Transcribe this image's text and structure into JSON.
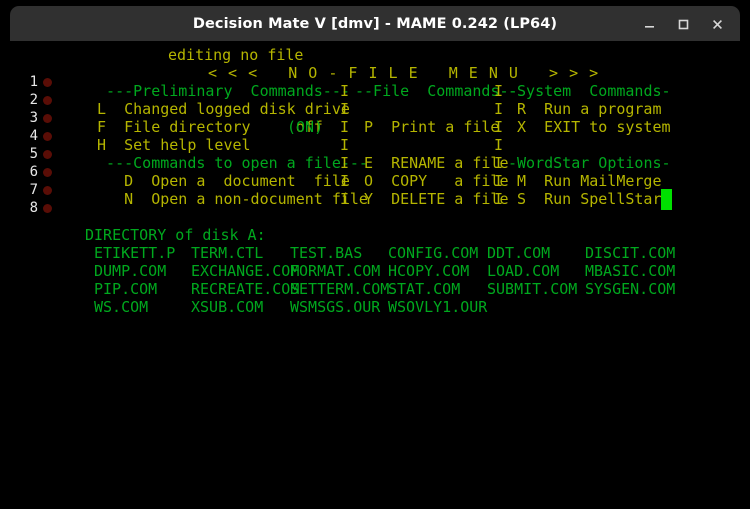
{
  "window": {
    "title": "Decision Mate V [dmv] - MAME 0.242 (LP64)",
    "controls": {
      "minimize_label": "minimize-window",
      "maximize_label": "maximize-window",
      "close_label": "close-window"
    }
  },
  "screen": {
    "status_line": "editing no file",
    "menu_header": "< < <   N O - F I L E   M E N U   > > >",
    "gutter": {
      "numbers": [
        "1",
        "2",
        "3",
        "4",
        "5",
        "6",
        "7",
        "8"
      ]
    },
    "menu": {
      "col1_rows": [
        "  ---Preliminary  Commands---",
        " L  Changed logged disk drive",
        " F  File directory     off ",
        " H  Set help level",
        "  ---Commands to open a file---",
        "    D  Open a  document  file",
        "    N  Open a non-document file"
      ],
      "file_dir_toggle": "(ON)",
      "col2_header": "--File  Commands--",
      "col2_rows": [
        "",
        "P  Print a file",
        "",
        "E  RENAME a file",
        "O  COPY   a file",
        "Y  DELETE a file"
      ],
      "col3_header": "-System  Commands-",
      "col3_rows": [
        "R  Run a program",
        "X  EXIT to system",
        ""
      ],
      "col3_header2": "-WordStar Options-",
      "col3_rows2": [
        "M  Run MailMerge",
        "S  Run SpellStar"
      ],
      "divider": "I"
    },
    "directory": {
      "title": "DIRECTORY of disk A:",
      "rows": [
        [
          "ETIKETT.P",
          "TERM.CTL",
          "TEST.BAS",
          "CONFIG.COM",
          "DDT.COM",
          "DISCIT.COM"
        ],
        [
          "DUMP.COM",
          "EXCHANGE.COM",
          "FORMAT.COM",
          "HCOPY.COM",
          "LOAD.COM",
          "MBASIC.COM"
        ],
        [
          "PIP.COM",
          "RECREATE.COM",
          "SETTERM.COM",
          "STAT.COM",
          "SUBMIT.COM",
          "SYSGEN.COM"
        ],
        [
          "WS.COM",
          "XSUB.COM",
          "WSMSGS.OUR",
          "WSOVLY1.OUR",
          "",
          ""
        ]
      ]
    },
    "cursor": {
      "visible": "true"
    }
  },
  "colors": {
    "background": "#000000",
    "yellow": "#b5b500",
    "green": "#00a81e",
    "cursor": "#00e000",
    "gutter_dot": "#5a0d06",
    "titlebar": "#303030"
  }
}
